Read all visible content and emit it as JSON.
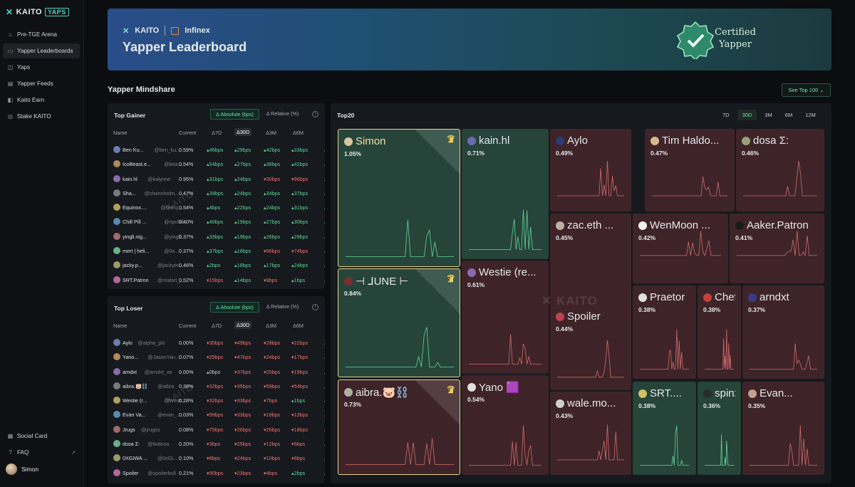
{
  "brand": {
    "name": "KAITO",
    "badge": "YAPS"
  },
  "sidebar": {
    "items": [
      {
        "label": "Pre-TGE Arena",
        "icon": "flame-icon"
      },
      {
        "label": "Yapper Leaderboards",
        "icon": "trophy-icon",
        "active": true
      },
      {
        "label": "Yaps",
        "icon": "chart-icon"
      },
      {
        "label": "Yapper Feeds",
        "icon": "feed-icon"
      },
      {
        "label": "Kaito Earn",
        "icon": "earn-icon"
      },
      {
        "label": "Stake KAITO",
        "icon": "stake-icon"
      }
    ],
    "bottom": [
      {
        "label": "Social Card",
        "icon": "card-icon"
      },
      {
        "label": "FAQ",
        "icon": "help-icon"
      }
    ],
    "user": "Simon"
  },
  "banner": {
    "kaito": "KAITO",
    "partner": "Infinex",
    "title": "Yapper Leaderboard",
    "badge_line1": "Certified",
    "badge_line2": "Yapper"
  },
  "section": {
    "title": "Yapper Mindshare",
    "see_top": "See Top 100"
  },
  "tables": {
    "toggle_abs": "Δ Absolute (bps)",
    "toggle_rel": "Δ Relative (%)",
    "headers": {
      "name": "Name",
      "current": "Current",
      "d7": "Δ7D",
      "d30": "Δ30D",
      "d3m": "Δ3M",
      "d6m": "Δ6M"
    },
    "gainer": {
      "title": "Top Gainer",
      "rows": [
        {
          "name": "Ben Ku...",
          "handle": "@ben_ku...",
          "cur": "0.59%",
          "d7": "46bps",
          "d30": "29bps",
          "d3m": "42bps",
          "d6m": "33bps",
          "s": [
            "u",
            "u",
            "u",
            "u"
          ]
        },
        {
          "name": "IcoBeast.e...",
          "handle": "@bea...",
          "cur": "0.54%",
          "d7": "54bps",
          "d30": "27bps",
          "d3m": "38bps",
          "d6m": "42bps",
          "s": [
            "u",
            "u",
            "u",
            "u"
          ]
        },
        {
          "name": "kain.hl",
          "handle": "@kalynne",
          "cur": "0.95%",
          "d7": "31bps",
          "d30": "24bps",
          "d3m": "30bps",
          "d6m": "96bps",
          "s": [
            "u",
            "u",
            "d",
            "d"
          ]
        },
        {
          "name": "Sha...",
          "handle": "@shannholm...",
          "cur": "0.47%",
          "d7": "39bps",
          "d30": "24bps",
          "d3m": "34bps",
          "d6m": "37bps",
          "s": [
            "u",
            "u",
            "u",
            "u"
          ]
        },
        {
          "name": "Equinox....",
          "handle": "@0xEq...",
          "cur": "0.54%",
          "d7": "4bps",
          "d30": "22bps",
          "d3m": "24bps",
          "d6m": "31bps",
          "s": [
            "u",
            "u",
            "u",
            "u"
          ]
        },
        {
          "name": "Chill Pill ...",
          "handle": "@ripchill...",
          "cur": "0.40%",
          "d7": "40bps",
          "d30": "19bps",
          "d3m": "27bps",
          "d6m": "30bps",
          "s": [
            "u",
            "u",
            "u",
            "u"
          ]
        },
        {
          "name": "yingli.nig...",
          "handle": "@yingli...",
          "cur": "0.37%",
          "d7": "33bps",
          "d30": "19bps",
          "d3m": "26bps",
          "d6m": "29bps",
          "s": [
            "u",
            "u",
            "u",
            "u"
          ]
        },
        {
          "name": "mert | heli...",
          "handle": "@0x...",
          "cur": "0.37%",
          "d7": "37bps",
          "d30": "18bps",
          "d3m": "96bps",
          "d6m": "74bps",
          "s": [
            "u",
            "u",
            "d",
            "d"
          ]
        },
        {
          "name": "jacky.p...",
          "handle": "@jackyin...",
          "cur": "0.46%",
          "d7": "2bps",
          "d30": "18bps",
          "d3m": "17bps",
          "d6m": "24bps",
          "s": [
            "u",
            "u",
            "u",
            "u"
          ]
        },
        {
          "name": "SRT.Patron",
          "handle": "@realsrt_...",
          "cur": "0.52%",
          "d7": "15bps",
          "d30": "14bps",
          "d3m": "8bps",
          "d6m": "1bps",
          "s": [
            "d",
            "u",
            "d",
            "u"
          ]
        }
      ]
    },
    "loser": {
      "title": "Top Loser",
      "rows": [
        {
          "name": "Aylo",
          "handle": "@alpha_pls",
          "cur": "0.00%",
          "d7": "35bps",
          "d30": "49bps",
          "d3m": "28bps",
          "d6m": "22bps",
          "s": [
            "d",
            "d",
            "d",
            "d"
          ]
        },
        {
          "name": "Yano...",
          "handle": "@JasonYan...",
          "cur": "0.07%",
          "d7": "25bps",
          "d30": "47bps",
          "d3m": "24bps",
          "d6m": "17bps",
          "s": [
            "d",
            "d",
            "d",
            "d"
          ]
        },
        {
          "name": "arndxt",
          "handle": "@arndxt_xo",
          "cur": "0.00%",
          "d7": "0bps",
          "d30": "37bps",
          "d3m": "25bps",
          "d6m": "19bps",
          "s": [
            "z",
            "d",
            "d",
            "d"
          ]
        },
        {
          "name": "aibra.🐷⛓️",
          "handle": "@aibra",
          "cur": "0.38%",
          "d7": "32bps",
          "d30": "35bps",
          "d3m": "59bps",
          "d6m": "54bps",
          "s": [
            "d",
            "d",
            "d",
            "d"
          ]
        },
        {
          "name": "Westie (r...",
          "handle": "@West...",
          "cur": "0.28%",
          "d7": "32bps",
          "d30": "33bps",
          "d3m": "7bps",
          "d6m": "1bps",
          "s": [
            "d",
            "d",
            "d",
            "u"
          ]
        },
        {
          "name": "Evan Va...",
          "handle": "@evan_...",
          "cur": "0.03%",
          "d7": "99bps",
          "d30": "33bps",
          "d3m": "18bps",
          "d6m": "13bps",
          "s": [
            "d",
            "d",
            "d",
            "d"
          ]
        },
        {
          "name": "Jrugs",
          "handle": "@jrugss",
          "cur": "0.08%",
          "d7": "75bps",
          "d30": "26bps",
          "d3m": "26bps",
          "d6m": "18bps",
          "s": [
            "d",
            "d",
            "d",
            "d"
          ]
        },
        {
          "name": "dosa Σ:",
          "handle": "@fwdosa",
          "cur": "0.20%",
          "d7": "3bps",
          "d30": "25bps",
          "d3m": "12bps",
          "d6m": "5bps",
          "s": [
            "d",
            "d",
            "d",
            "d"
          ]
        },
        {
          "name": "0XGIWA ...",
          "handle": "@0xGi...",
          "cur": "0.10%",
          "d7": "8bps",
          "d30": "24bps",
          "d3m": "10bps",
          "d6m": "6bps",
          "s": [
            "d",
            "d",
            "d",
            "d"
          ]
        },
        {
          "name": "Spoiler",
          "handle": "@spoilerbull",
          "cur": "0.21%",
          "d7": "90bps",
          "d30": "23bps",
          "d3m": "4bps",
          "d6m": "2bps",
          "s": [
            "d",
            "d",
            "d",
            "u"
          ]
        }
      ]
    }
  },
  "treemap": {
    "title": "Top20",
    "periods": [
      "7D",
      "30D",
      "3M",
      "6M",
      "12M"
    ],
    "active_period": "30D",
    "watermark": "KAITO",
    "cells": [
      {
        "name": "Simon",
        "pct": "1.05%",
        "c": "g",
        "rank": "1"
      },
      {
        "name": "kain.hl",
        "pct": "0.71%",
        "c": "g"
      },
      {
        "name": "Aylo",
        "pct": "0.49%",
        "c": "r"
      },
      {
        "name": "Tim Haldo...",
        "pct": "0.47%",
        "c": "r"
      },
      {
        "name": "dosa Σ:",
        "pct": "0.46%",
        "c": "r"
      },
      {
        "name": "zac.eth ...",
        "pct": "0.45%",
        "c": "r"
      },
      {
        "name": "WenMoon ...",
        "pct": "0.42%",
        "c": "r"
      },
      {
        "name": "Aaker.Patron",
        "pct": "0.41%",
        "c": "r"
      },
      {
        "name": "⊣ ⅃UNE ⊢",
        "pct": "0.84%",
        "c": "g",
        "rank": "2"
      },
      {
        "name": "Westie (re...",
        "pct": "0.61%",
        "c": "r"
      },
      {
        "name": "Praetor",
        "pct": "0.38%",
        "c": "r"
      },
      {
        "name": "Chef ...",
        "pct": "0.38%",
        "c": "r"
      },
      {
        "name": "arndxt",
        "pct": "0.37%",
        "c": "r"
      },
      {
        "name": "Spoiler",
        "pct": "0.44%",
        "c": "r"
      },
      {
        "name": "aibra.🐷⛓️",
        "pct": "0.73%",
        "c": "r",
        "rank": "3"
      },
      {
        "name": "Yano 🟪",
        "pct": "0.54%",
        "c": "r"
      },
      {
        "name": "wale.mo...",
        "pct": "0.43%",
        "c": "r"
      },
      {
        "name": "SRT....",
        "pct": "0.38%",
        "c": "g"
      },
      {
        "name": "spinx...",
        "pct": "0.36%",
        "c": "g"
      },
      {
        "name": "Evan...",
        "pct": "0.35%",
        "c": "r"
      }
    ]
  }
}
